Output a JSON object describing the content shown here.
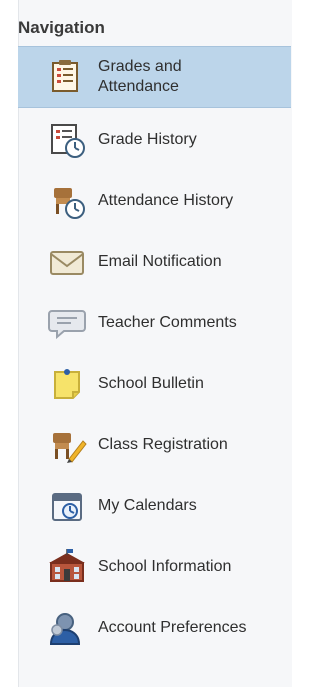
{
  "navigation": {
    "header": "Navigation",
    "items": [
      {
        "label": "Grades and Attendance",
        "icon": "grades-checklist-icon",
        "active": true
      },
      {
        "label": "Grade History",
        "icon": "grade-history-icon",
        "active": false
      },
      {
        "label": "Attendance History",
        "icon": "attendance-history-icon",
        "active": false
      },
      {
        "label": "Email Notification",
        "icon": "email-icon",
        "active": false
      },
      {
        "label": "Teacher Comments",
        "icon": "comments-icon",
        "active": false
      },
      {
        "label": "School Bulletin",
        "icon": "bulletin-icon",
        "active": false
      },
      {
        "label": "Class Registration",
        "icon": "registration-icon",
        "active": false
      },
      {
        "label": "My Calendars",
        "icon": "calendar-icon",
        "active": false
      },
      {
        "label": "School Information",
        "icon": "school-icon",
        "active": false
      },
      {
        "label": "Account Preferences",
        "icon": "account-icon",
        "active": false
      }
    ]
  },
  "colors": {
    "active_bg": "#bcd5ea",
    "panel_bg": "#f6f7f9"
  }
}
